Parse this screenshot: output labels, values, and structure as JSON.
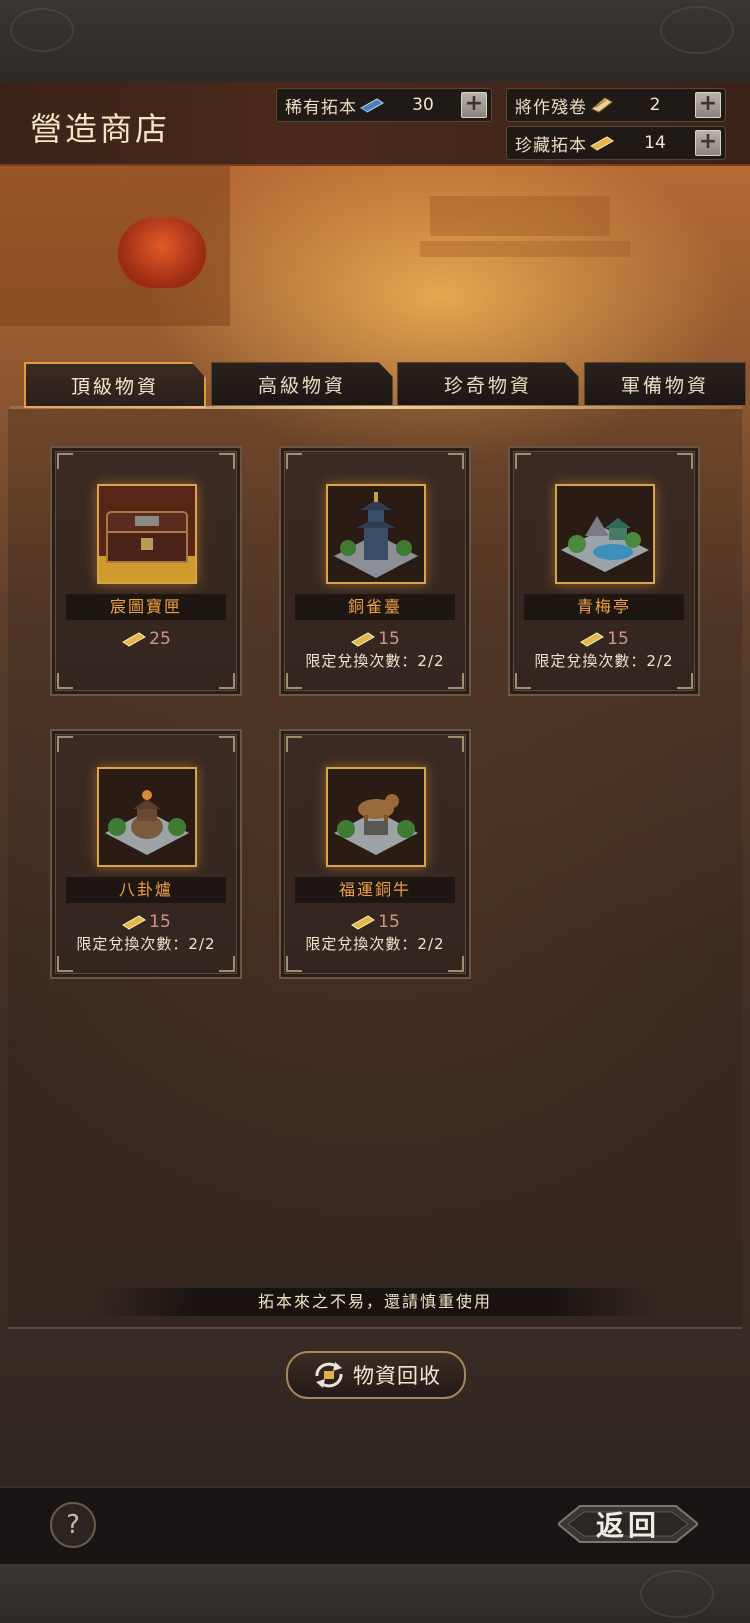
{
  "header": {
    "title": "營造商店",
    "resources": [
      {
        "label": "稀有拓本",
        "count": "30",
        "icon": "blue-book-icon"
      },
      {
        "label": "將作殘卷",
        "count": "2",
        "icon": "scroll-fragment-icon"
      },
      {
        "label": "珍藏拓本",
        "count": "14",
        "icon": "gold-book-icon"
      }
    ]
  },
  "tabs": [
    {
      "label": "頂級物資",
      "active": true
    },
    {
      "label": "高級物資",
      "active": false
    },
    {
      "label": "珍奇物資",
      "active": false
    },
    {
      "label": "軍備物資",
      "active": false
    }
  ],
  "items": [
    {
      "name": "宸圖寶匣",
      "price": "25",
      "limit": "",
      "icon": "treasure-chest-icon"
    },
    {
      "name": "銅雀臺",
      "price": "15",
      "limit": "限定兌換次數：2/2",
      "icon": "pagoda-building-icon"
    },
    {
      "name": "青梅亭",
      "price": "15",
      "limit": "限定兌換次數：2/2",
      "icon": "garden-pavilion-icon"
    },
    {
      "name": "八卦爐",
      "price": "15",
      "limit": "限定兌換次數：2/2",
      "icon": "bagua-furnace-icon"
    },
    {
      "name": "福運銅牛",
      "price": "15",
      "limit": "限定兌換次數：2/2",
      "icon": "bronze-ox-icon"
    }
  ],
  "notice": "拓本來之不易，還請慎重使用",
  "recycle_label": "物資回收",
  "help_label": "?",
  "back_label": "返回",
  "colors": {
    "accent": "#e29a3e",
    "item_name": "#f0a048",
    "price": "#d39582"
  }
}
